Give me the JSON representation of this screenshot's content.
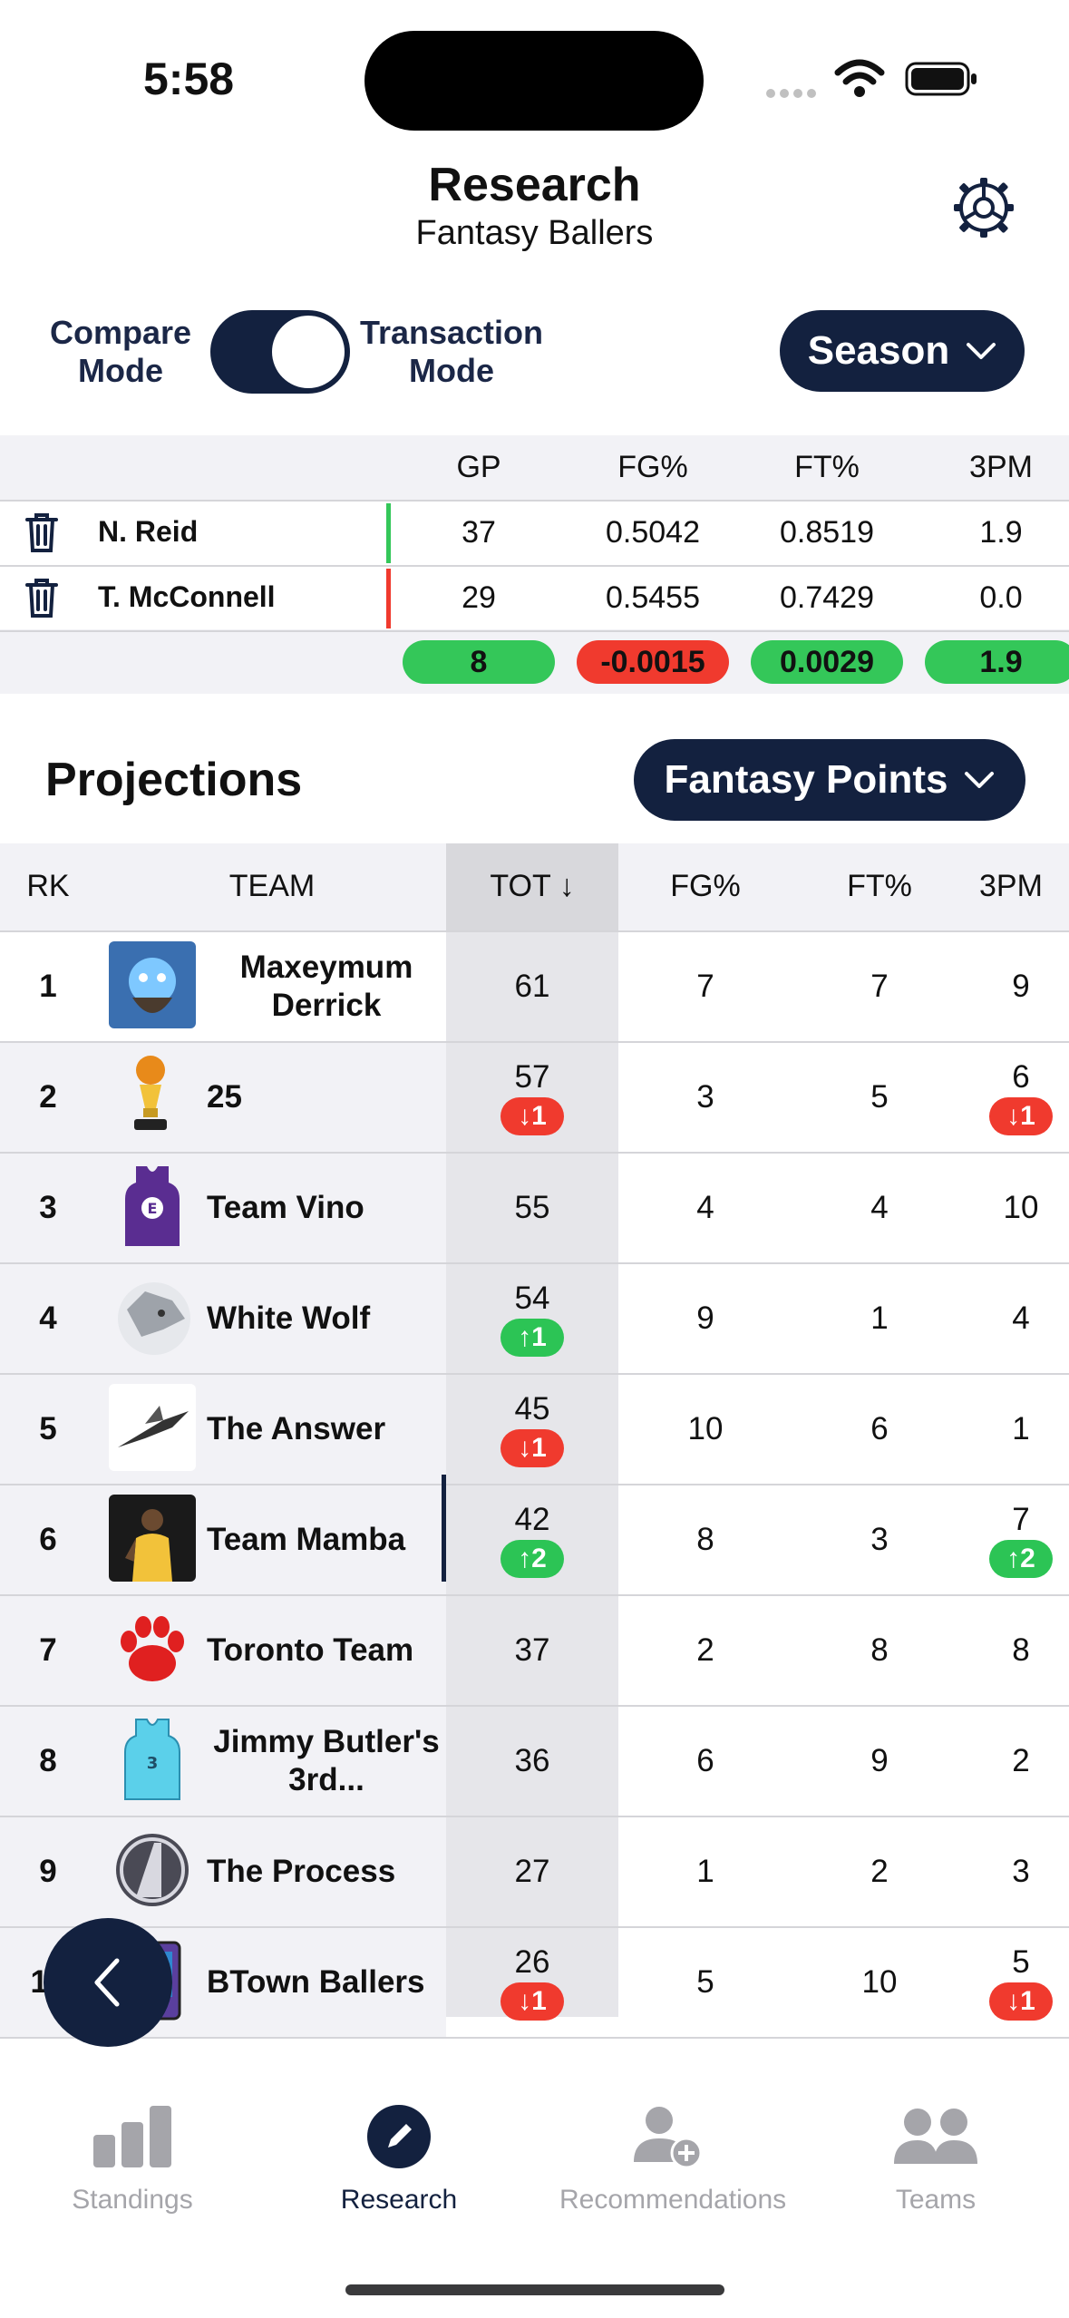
{
  "status_bar": {
    "time": "5:58"
  },
  "header": {
    "title": "Research",
    "subtitle": "Fantasy Ballers"
  },
  "mode": {
    "left_label": "Compare Mode",
    "right_label": "Transaction Mode",
    "season_label": "Season"
  },
  "compare": {
    "headers": [
      "GP",
      "FG%",
      "FT%",
      "3PM"
    ],
    "players": [
      {
        "name": "N. Reid",
        "values": [
          "37",
          "0.5042",
          "0.8519",
          "1.9"
        ],
        "accent": "#34c759"
      },
      {
        "name": "T. McConnell",
        "values": [
          "29",
          "0.5455",
          "0.7429",
          "0.0"
        ],
        "accent": "#f03a2e"
      }
    ],
    "diffs": [
      {
        "value": "8",
        "color": "#34c759"
      },
      {
        "value": "-0.0015",
        "color": "#f03a2e"
      },
      {
        "value": "0.0029",
        "color": "#34c759"
      },
      {
        "value": "1.9",
        "color": "#34c759"
      }
    ]
  },
  "projections": {
    "title": "Projections",
    "metric_label": "Fantasy Points",
    "columns": {
      "rk": "RK",
      "team": "TEAM",
      "tot": "TOT ↓",
      "fg": "FG%",
      "ft": "FT%",
      "tpm": "3PM"
    },
    "rows": [
      {
        "rk": "1",
        "team": "Maxeymum Derrick",
        "tot": "61",
        "tot_change": "",
        "tot_dir": "",
        "fg": "7",
        "ft": "7",
        "tpm": "9",
        "tpm_change": "",
        "tpm_dir": "",
        "logo": "avatar-blue-face"
      },
      {
        "rk": "2",
        "team": "25",
        "tot": "57",
        "tot_change": "↓1",
        "tot_dir": "dn",
        "fg": "3",
        "ft": "5",
        "tpm": "6",
        "tpm_change": "↓1",
        "tpm_dir": "dn",
        "logo": "trophy-icon"
      },
      {
        "rk": "3",
        "team": "Team Vino",
        "tot": "55",
        "tot_change": "",
        "tot_dir": "",
        "fg": "4",
        "ft": "4",
        "tpm": "10",
        "tpm_change": "",
        "tpm_dir": "",
        "logo": "jersey-purple"
      },
      {
        "rk": "4",
        "team": "White Wolf",
        "tot": "54",
        "tot_change": "↑1",
        "tot_dir": "up",
        "fg": "9",
        "ft": "1",
        "tpm": "4",
        "tpm_change": "",
        "tpm_dir": "",
        "logo": "wolf-icon"
      },
      {
        "rk": "5",
        "team": "The Answer",
        "tot": "45",
        "tot_change": "↓1",
        "tot_dir": "dn",
        "fg": "10",
        "ft": "6",
        "tpm": "1",
        "tpm_change": "",
        "tpm_dir": "",
        "logo": "jet-icon"
      },
      {
        "rk": "6",
        "team": "Team Mamba",
        "tot": "42",
        "tot_change": "↑2",
        "tot_dir": "up",
        "fg": "8",
        "ft": "3",
        "tpm": "7",
        "tpm_change": "↑2",
        "tpm_dir": "up",
        "logo": "player-photo"
      },
      {
        "rk": "7",
        "team": "Toronto  Team",
        "tot": "37",
        "tot_change": "",
        "tot_dir": "",
        "fg": "2",
        "ft": "8",
        "tpm": "8",
        "tpm_change": "",
        "tpm_dir": "",
        "logo": "paw-icon"
      },
      {
        "rk": "8",
        "team": "Jimmy Butler's 3rd...",
        "tot": "36",
        "tot_change": "",
        "tot_dir": "",
        "fg": "6",
        "ft": "9",
        "tpm": "2",
        "tpm_change": "",
        "tpm_dir": "",
        "logo": "jersey-cyan"
      },
      {
        "rk": "9",
        "team": "The Process",
        "tot": "27",
        "tot_change": "",
        "tot_dir": "",
        "fg": "1",
        "ft": "2",
        "tpm": "3",
        "tpm_change": "",
        "tpm_dir": "",
        "logo": "avengers-icon"
      },
      {
        "rk": "10",
        "team": "BTown Ballers",
        "tot": "26",
        "tot_change": "↓1",
        "tot_dir": "dn",
        "fg": "5",
        "ft": "10",
        "tpm": "5",
        "tpm_change": "↓1",
        "tpm_dir": "dn",
        "logo": "card-icon"
      }
    ]
  },
  "tabs": [
    {
      "label": "Standings",
      "icon": "bar-chart-icon",
      "active": false
    },
    {
      "label": "Research",
      "icon": "pencil-icon",
      "active": true
    },
    {
      "label": "Recommendations",
      "icon": "add-user-icon",
      "active": false
    },
    {
      "label": "Teams",
      "icon": "people-icon",
      "active": false
    }
  ],
  "colors": {
    "navy": "#13213f",
    "green": "#34c759",
    "red": "#f03a2e"
  }
}
